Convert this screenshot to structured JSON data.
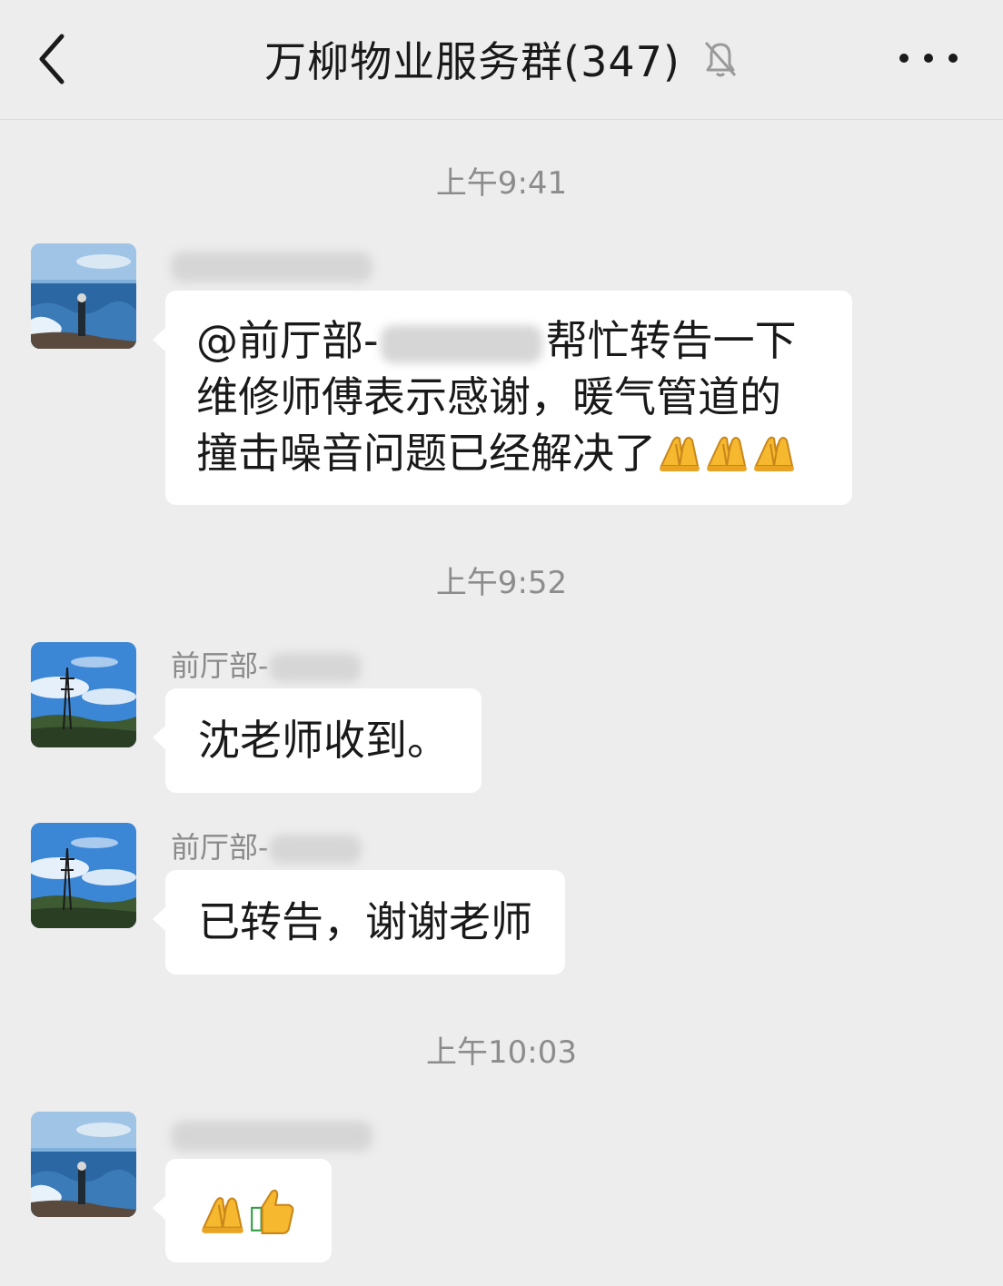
{
  "header": {
    "title": "万柳物业服务群(347)",
    "back_icon": "chevron-left-icon",
    "mute_icon": "bell-off-icon",
    "more_icon": "more-dots-icon"
  },
  "colors": {
    "background": "#ededed",
    "bubble": "#ffffff",
    "timestamp_text": "#8c8c8c",
    "sender_text": "#8a8a8a"
  },
  "messages": [
    {
      "time": "上午9:41",
      "sender": "",
      "sender_redacted": true,
      "avatar": "ocean-rock-avatar",
      "lines": {
        "0": "@前厅部-",
        "0b": "帮忙转告一下",
        "1": "维修师傅表示感谢，暖气管道的",
        "2": "撞击噪音问题已经解决了"
      },
      "mention_redacted": true,
      "emojis": [
        "folded-hands-emoji",
        "folded-hands-emoji",
        "folded-hands-emoji"
      ]
    },
    {
      "time": "上午9:52",
      "sender": "前厅部-",
      "sender_redacted": true,
      "avatar": "power-tower-avatar",
      "text": "沈老师收到。"
    },
    {
      "sender": "前厅部-",
      "sender_redacted": true,
      "avatar": "power-tower-avatar",
      "text": "已转告，谢谢老师"
    },
    {
      "time": "上午10:03",
      "sender": "",
      "sender_redacted": true,
      "avatar": "ocean-rock-avatar",
      "emojis": [
        "folded-hands-emoji",
        "thumbs-up-emoji"
      ]
    }
  ]
}
